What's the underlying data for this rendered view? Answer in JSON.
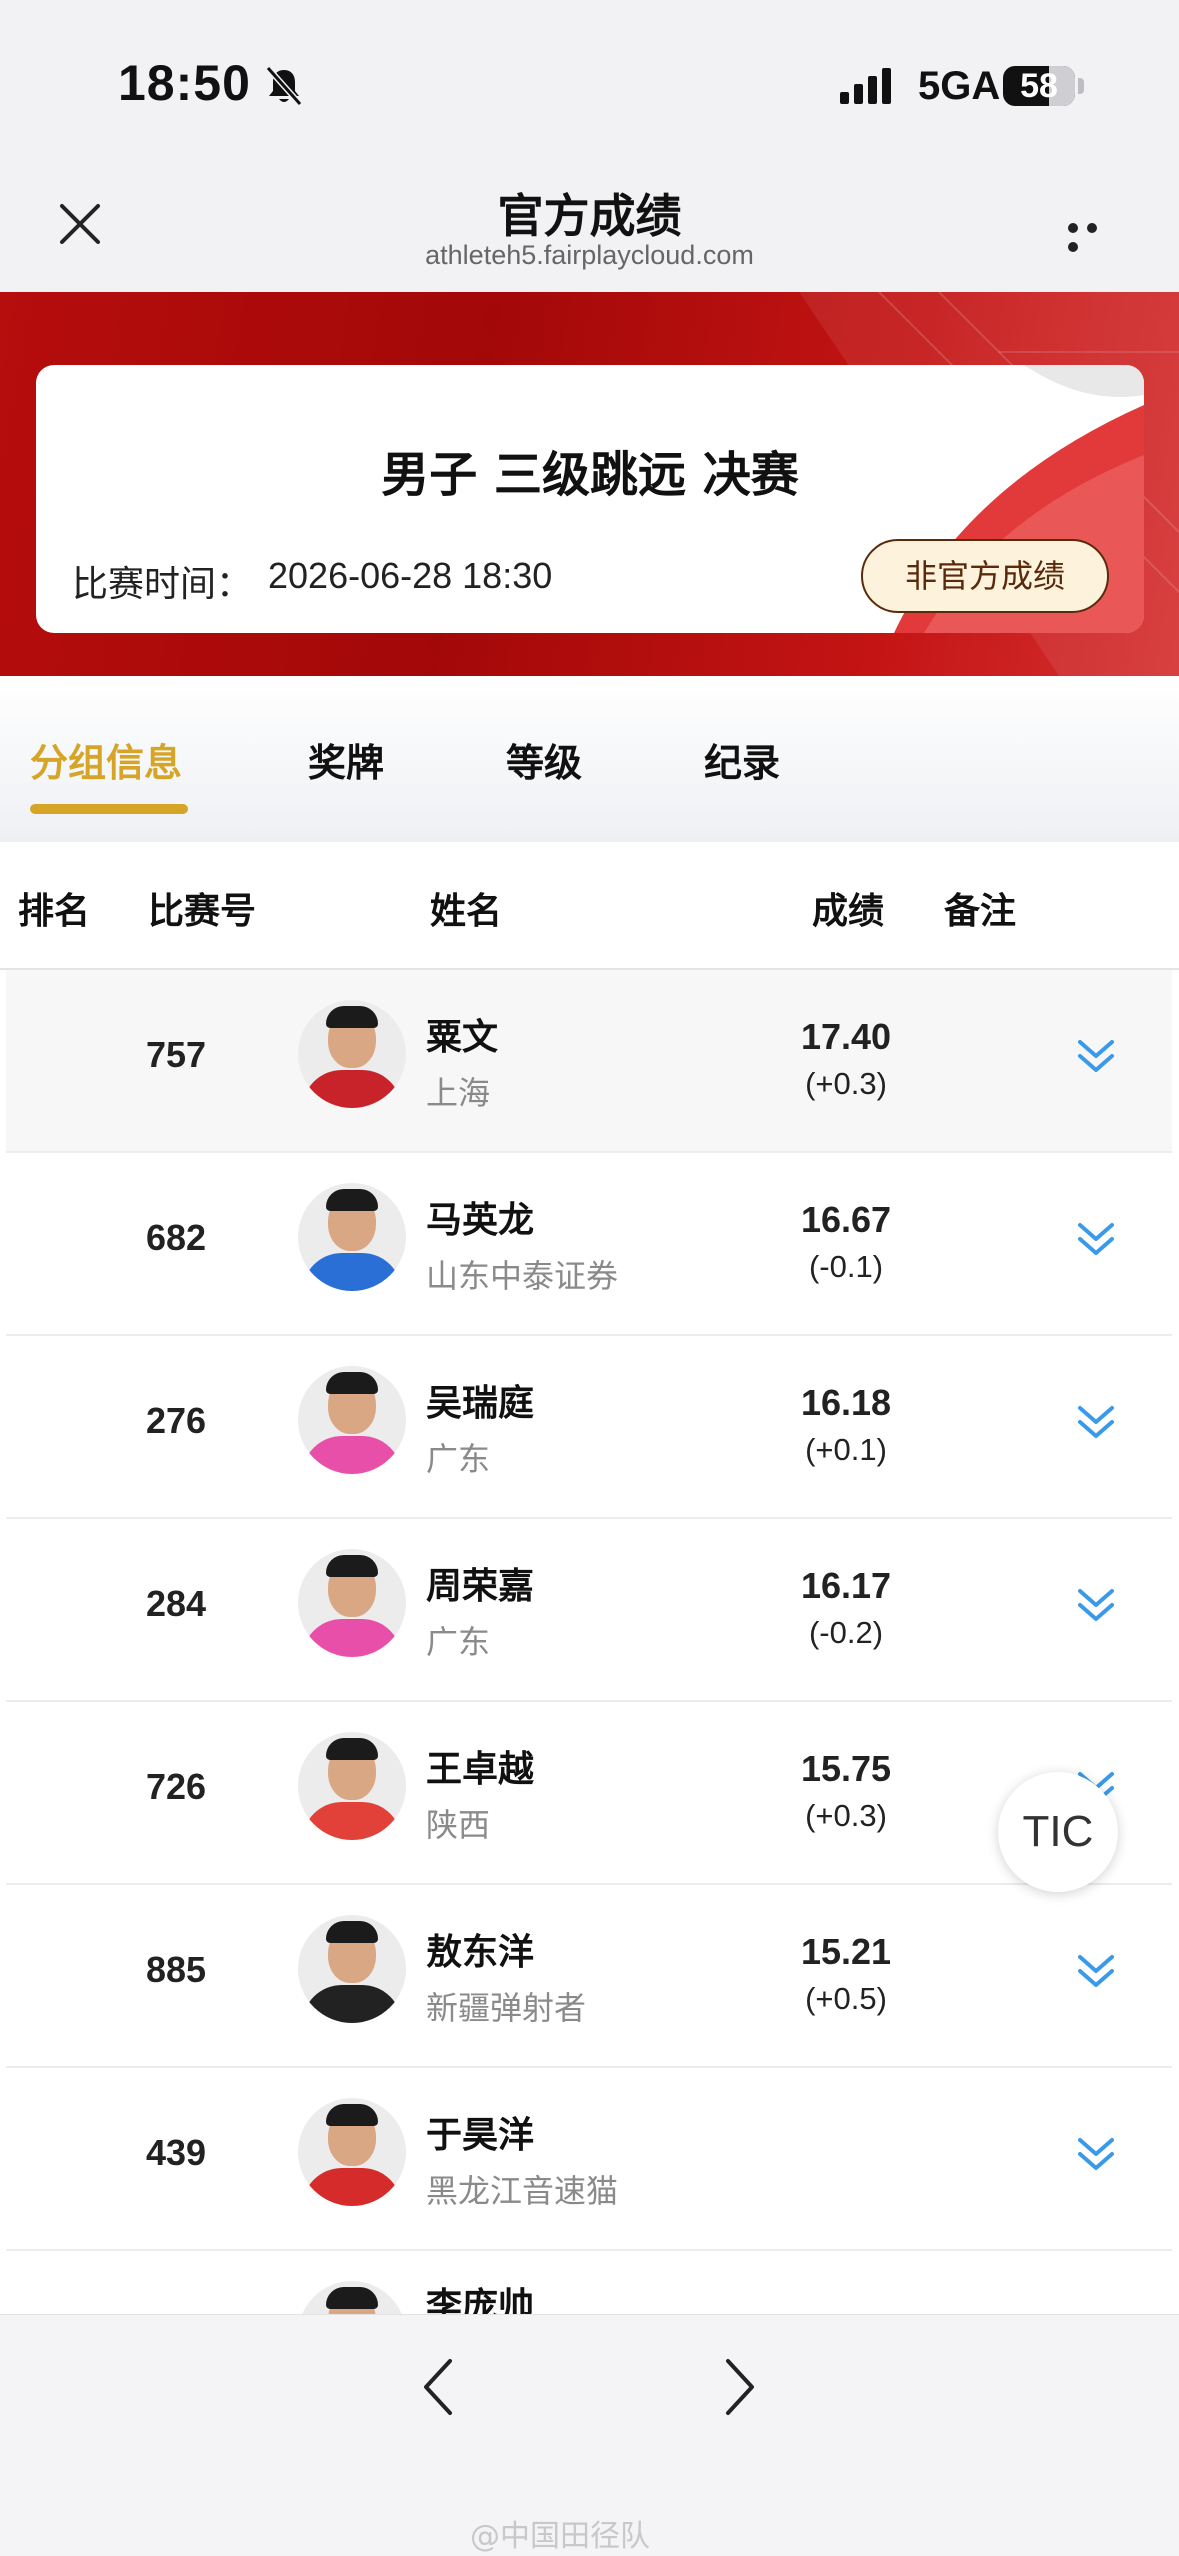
{
  "status_bar": {
    "time": "18:50",
    "network": "5GA",
    "battery": "58"
  },
  "nav": {
    "title": "官方成绩",
    "url": "athleteh5.fairplaycloud.com"
  },
  "event": {
    "title": "男子 三级跳远 决赛",
    "time_label": "比赛时间：",
    "time_value": "2026-06-28  18:30",
    "status_button": "非官方成绩"
  },
  "tabs": [
    {
      "label": "分组信息",
      "active": true
    },
    {
      "label": "奖牌",
      "active": false
    },
    {
      "label": "等级",
      "active": false
    },
    {
      "label": "纪录",
      "active": false
    }
  ],
  "table": {
    "headers": {
      "rank": "排名",
      "bib": "比赛号",
      "name": "姓名",
      "result": "成绩",
      "note": "备注"
    },
    "rows": [
      {
        "bib": "757",
        "name": "粟文",
        "team": "上海",
        "result": "17.40",
        "wind": "(+0.3)",
        "shirt": "#c8232a"
      },
      {
        "bib": "682",
        "name": "马英龙",
        "team": "山东中泰证券",
        "result": "16.67",
        "wind": "(-0.1)",
        "shirt": "#2a6fd6"
      },
      {
        "bib": "276",
        "name": "吴瑞庭",
        "team": "广东",
        "result": "16.18",
        "wind": "(+0.1)",
        "shirt": "#e84fa8"
      },
      {
        "bib": "284",
        "name": "周荣嘉",
        "team": "广东",
        "result": "16.17",
        "wind": "(-0.2)",
        "shirt": "#e84fa8"
      },
      {
        "bib": "726",
        "name": "王卓越",
        "team": "陕西",
        "result": "15.75",
        "wind": "(+0.3)",
        "shirt": "#e2413a"
      },
      {
        "bib": "885",
        "name": "敖东洋",
        "team": "新疆弹射者",
        "result": "15.21",
        "wind": "(+0.5)",
        "shirt": "#222222"
      },
      {
        "bib": "439",
        "name": "于昊洋",
        "team": "黑龙江音速猫",
        "result": "",
        "wind": "",
        "shirt": "#d62b2b"
      },
      {
        "bib": "",
        "name": "李庞帅",
        "team": "",
        "result": "",
        "wind": "",
        "shirt": "#444444"
      }
    ]
  },
  "floating": {
    "label": "TIC"
  },
  "watermark": "@中国田径队",
  "colors": {
    "banner_red": "#b60d0d",
    "accent_gold": "#d6a527",
    "expand_blue": "#3b9ae8"
  },
  "icons": {
    "close": "close-icon",
    "more": "more-icon",
    "expand": "chevron-double-down-icon",
    "back": "chevron-left-icon",
    "forward": "chevron-right-icon"
  }
}
